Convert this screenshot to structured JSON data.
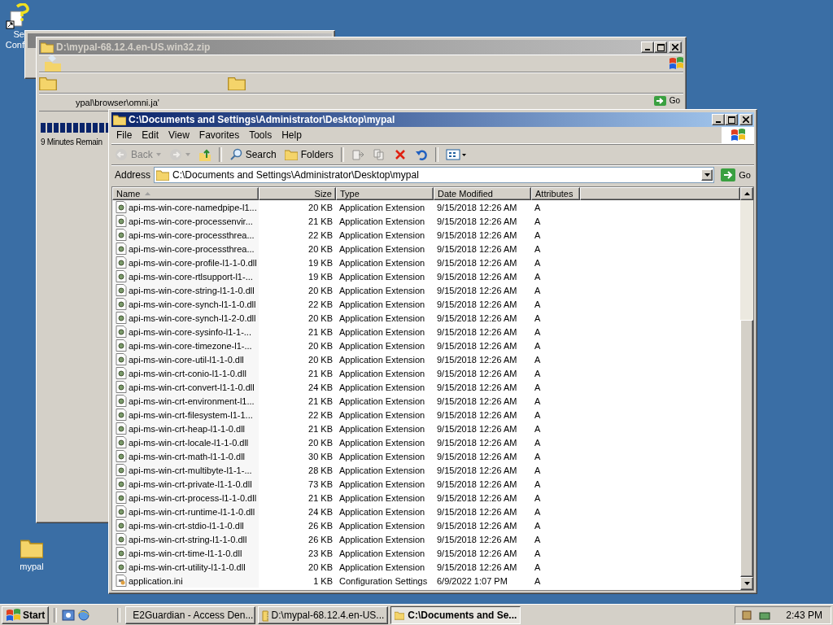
{
  "desktop_icons": [
    {
      "kind": "help-shortcut",
      "lines": [
        "Se",
        "Conf"
      ]
    },
    {
      "kind": "folder",
      "lines": [
        "mypal"
      ]
    }
  ],
  "zip_window": {
    "title": "D:\\mypal-68.12.4.en-US.win32.zip",
    "path_text": "ypal\\browser\\omni.ja'",
    "time_remaining": "9 Minutes Remain",
    "go_button": "Go"
  },
  "explorer": {
    "title": "C:\\Documents and Settings\\Administrator\\Desktop\\mypal",
    "menu": [
      "File",
      "Edit",
      "View",
      "Favorites",
      "Tools",
      "Help"
    ],
    "toolbar": [
      {
        "kind": "back",
        "label": "Back",
        "disabled": true
      },
      {
        "kind": "forward",
        "disabled": true
      },
      {
        "kind": "up",
        "disabled": false
      },
      {
        "kind": "search",
        "label": "Search",
        "disabled": false
      },
      {
        "kind": "folders",
        "label": "Folders",
        "disabled": false
      },
      {
        "kind": "move",
        "disabled": true
      },
      {
        "kind": "copy",
        "disabled": true
      },
      {
        "kind": "delete",
        "disabled": false
      },
      {
        "kind": "undo",
        "disabled": false
      },
      {
        "kind": "views"
      }
    ],
    "address": {
      "label": "Address",
      "value": "C:\\Documents and Settings\\Administrator\\Desktop\\mypal",
      "go_button": "Go"
    },
    "columns": [
      {
        "label": "Name",
        "sorted": true
      },
      {
        "label": "Size",
        "sorted": false
      },
      {
        "label": "Type",
        "sorted": false
      },
      {
        "label": "Date Modified",
        "sorted": false
      },
      {
        "label": "Attributes",
        "sorted": false
      }
    ],
    "rows": [
      {
        "kind": "dll",
        "name": "api-ms-win-core-namedpipe-l1...",
        "size": "20 KB",
        "type": "Application Extension",
        "date": "9/15/2018 12:26 AM",
        "attributes": "A"
      },
      {
        "kind": "dll",
        "name": "api-ms-win-core-processenvir...",
        "size": "21 KB",
        "type": "Application Extension",
        "date": "9/15/2018 12:26 AM",
        "attributes": "A"
      },
      {
        "kind": "dll",
        "name": "api-ms-win-core-processthrea...",
        "size": "22 KB",
        "type": "Application Extension",
        "date": "9/15/2018 12:26 AM",
        "attributes": "A"
      },
      {
        "kind": "dll",
        "name": "api-ms-win-core-processthrea...",
        "size": "20 KB",
        "type": "Application Extension",
        "date": "9/15/2018 12:26 AM",
        "attributes": "A"
      },
      {
        "kind": "dll",
        "name": "api-ms-win-core-profile-l1-1-0.dll",
        "size": "19 KB",
        "type": "Application Extension",
        "date": "9/15/2018 12:26 AM",
        "attributes": "A"
      },
      {
        "kind": "dll",
        "name": "api-ms-win-core-rtlsupport-l1-...",
        "size": "19 KB",
        "type": "Application Extension",
        "date": "9/15/2018 12:26 AM",
        "attributes": "A"
      },
      {
        "kind": "dll",
        "name": "api-ms-win-core-string-l1-1-0.dll",
        "size": "20 KB",
        "type": "Application Extension",
        "date": "9/15/2018 12:26 AM",
        "attributes": "A"
      },
      {
        "kind": "dll",
        "name": "api-ms-win-core-synch-l1-1-0.dll",
        "size": "22 KB",
        "type": "Application Extension",
        "date": "9/15/2018 12:26 AM",
        "attributes": "A"
      },
      {
        "kind": "dll",
        "name": "api-ms-win-core-synch-l1-2-0.dll",
        "size": "20 KB",
        "type": "Application Extension",
        "date": "9/15/2018 12:26 AM",
        "attributes": "A"
      },
      {
        "kind": "dll",
        "name": "api-ms-win-core-sysinfo-l1-1-...",
        "size": "21 KB",
        "type": "Application Extension",
        "date": "9/15/2018 12:26 AM",
        "attributes": "A"
      },
      {
        "kind": "dll",
        "name": "api-ms-win-core-timezone-l1-...",
        "size": "20 KB",
        "type": "Application Extension",
        "date": "9/15/2018 12:26 AM",
        "attributes": "A"
      },
      {
        "kind": "dll",
        "name": "api-ms-win-core-util-l1-1-0.dll",
        "size": "20 KB",
        "type": "Application Extension",
        "date": "9/15/2018 12:26 AM",
        "attributes": "A"
      },
      {
        "kind": "dll",
        "name": "api-ms-win-crt-conio-l1-1-0.dll",
        "size": "21 KB",
        "type": "Application Extension",
        "date": "9/15/2018 12:26 AM",
        "attributes": "A"
      },
      {
        "kind": "dll",
        "name": "api-ms-win-crt-convert-l1-1-0.dll",
        "size": "24 KB",
        "type": "Application Extension",
        "date": "9/15/2018 12:26 AM",
        "attributes": "A"
      },
      {
        "kind": "dll",
        "name": "api-ms-win-crt-environment-l1...",
        "size": "21 KB",
        "type": "Application Extension",
        "date": "9/15/2018 12:26 AM",
        "attributes": "A"
      },
      {
        "kind": "dll",
        "name": "api-ms-win-crt-filesystem-l1-1...",
        "size": "22 KB",
        "type": "Application Extension",
        "date": "9/15/2018 12:26 AM",
        "attributes": "A"
      },
      {
        "kind": "dll",
        "name": "api-ms-win-crt-heap-l1-1-0.dll",
        "size": "21 KB",
        "type": "Application Extension",
        "date": "9/15/2018 12:26 AM",
        "attributes": "A"
      },
      {
        "kind": "dll",
        "name": "api-ms-win-crt-locale-l1-1-0.dll",
        "size": "20 KB",
        "type": "Application Extension",
        "date": "9/15/2018 12:26 AM",
        "attributes": "A"
      },
      {
        "kind": "dll",
        "name": "api-ms-win-crt-math-l1-1-0.dll",
        "size": "30 KB",
        "type": "Application Extension",
        "date": "9/15/2018 12:26 AM",
        "attributes": "A"
      },
      {
        "kind": "dll",
        "name": "api-ms-win-crt-multibyte-l1-1-...",
        "size": "28 KB",
        "type": "Application Extension",
        "date": "9/15/2018 12:26 AM",
        "attributes": "A"
      },
      {
        "kind": "dll",
        "name": "api-ms-win-crt-private-l1-1-0.dll",
        "size": "73 KB",
        "type": "Application Extension",
        "date": "9/15/2018 12:26 AM",
        "attributes": "A"
      },
      {
        "kind": "dll",
        "name": "api-ms-win-crt-process-l1-1-0.dll",
        "size": "21 KB",
        "type": "Application Extension",
        "date": "9/15/2018 12:26 AM",
        "attributes": "A"
      },
      {
        "kind": "dll",
        "name": "api-ms-win-crt-runtime-l1-1-0.dll",
        "size": "24 KB",
        "type": "Application Extension",
        "date": "9/15/2018 12:26 AM",
        "attributes": "A"
      },
      {
        "kind": "dll",
        "name": "api-ms-win-crt-stdio-l1-1-0.dll",
        "size": "26 KB",
        "type": "Application Extension",
        "date": "9/15/2018 12:26 AM",
        "attributes": "A"
      },
      {
        "kind": "dll",
        "name": "api-ms-win-crt-string-l1-1-0.dll",
        "size": "26 KB",
        "type": "Application Extension",
        "date": "9/15/2018 12:26 AM",
        "attributes": "A"
      },
      {
        "kind": "dll",
        "name": "api-ms-win-crt-time-l1-1-0.dll",
        "size": "23 KB",
        "type": "Application Extension",
        "date": "9/15/2018 12:26 AM",
        "attributes": "A"
      },
      {
        "kind": "dll",
        "name": "api-ms-win-crt-utility-l1-1-0.dll",
        "size": "20 KB",
        "type": "Application Extension",
        "date": "9/15/2018 12:26 AM",
        "attributes": "A"
      },
      {
        "kind": "ini",
        "name": "application.ini",
        "size": "1 KB",
        "type": "Configuration Settings",
        "date": "6/9/2022 1:07 PM",
        "attributes": "A"
      }
    ]
  },
  "taskbar": {
    "start": "Start",
    "tasks": [
      {
        "kind": "browser",
        "label": "E2Guardian - Access Den...",
        "selected": false
      },
      {
        "kind": "zip",
        "label": "D:\\mypal-68.12.4.en-US...",
        "selected": false
      },
      {
        "kind": "folder",
        "label": "C:\\Documents and Se...",
        "selected": true
      }
    ],
    "clock": "2:43 PM"
  }
}
